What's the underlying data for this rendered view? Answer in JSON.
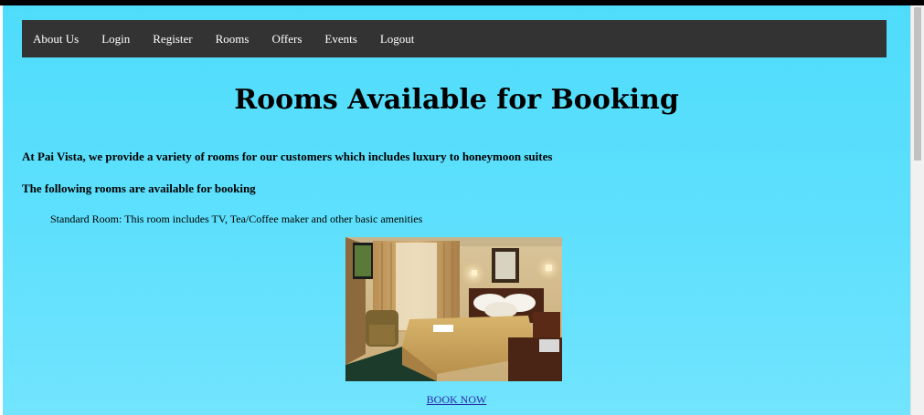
{
  "nav": {
    "items": [
      {
        "label": "About Us"
      },
      {
        "label": "Login"
      },
      {
        "label": "Register"
      },
      {
        "label": "Rooms"
      },
      {
        "label": "Offers"
      },
      {
        "label": "Events"
      },
      {
        "label": "Logout"
      }
    ]
  },
  "main": {
    "title": "Rooms Available for Booking",
    "intro": "At Pai Vista, we provide a variety of rooms for our customers which includes luxury to honeymoon suites",
    "following": "The following rooms are available for booking",
    "room": {
      "description": "Standard Room: This room includes TV, Tea/Coffee maker and other basic amenities",
      "book_label": "BOOK NOW"
    }
  },
  "colors": {
    "navbar_bg": "#333333",
    "page_bg": "#5ee0fd",
    "link": "#2a2aa8"
  }
}
